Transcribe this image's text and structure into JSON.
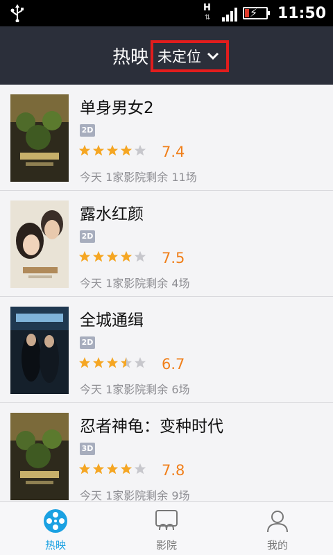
{
  "statusbar": {
    "network": "H",
    "time": "11:50",
    "icons": [
      "usb-icon",
      "network-h-icon",
      "signal-icon",
      "battery-charging-icon"
    ]
  },
  "header": {
    "title": "热映",
    "location": "未定位",
    "dropdown_icon": "chevron-down-icon"
  },
  "movies": [
    {
      "title": "单身男女2",
      "format": "2D",
      "stars": 4,
      "rating": "7.4",
      "info": "今天 1家影院剩余 11场"
    },
    {
      "title": "露水红颜",
      "format": "2D",
      "stars": 4,
      "rating": "7.5",
      "info": "今天 1家影院剩余 4场"
    },
    {
      "title": "全城通缉",
      "format": "2D",
      "stars": 3.5,
      "rating": "6.7",
      "info": "今天 1家影院剩余 6场"
    },
    {
      "title": "忍者神龟：变种时代",
      "format": "3D",
      "stars": 4,
      "rating": "7.8",
      "info": "今天 1家影院剩余 9场"
    }
  ],
  "bottomnav": {
    "tabs": [
      {
        "label": "热映",
        "icon": "film-reel-icon",
        "active": true
      },
      {
        "label": "影院",
        "icon": "cinema-seats-icon",
        "active": false
      },
      {
        "label": "我的",
        "icon": "user-icon",
        "active": false
      }
    ]
  },
  "colors": {
    "header_bg": "#2b2f3a",
    "accent": "#1ba1e2",
    "rating": "#f07f1a",
    "highlight_box": "#e11d1d"
  }
}
